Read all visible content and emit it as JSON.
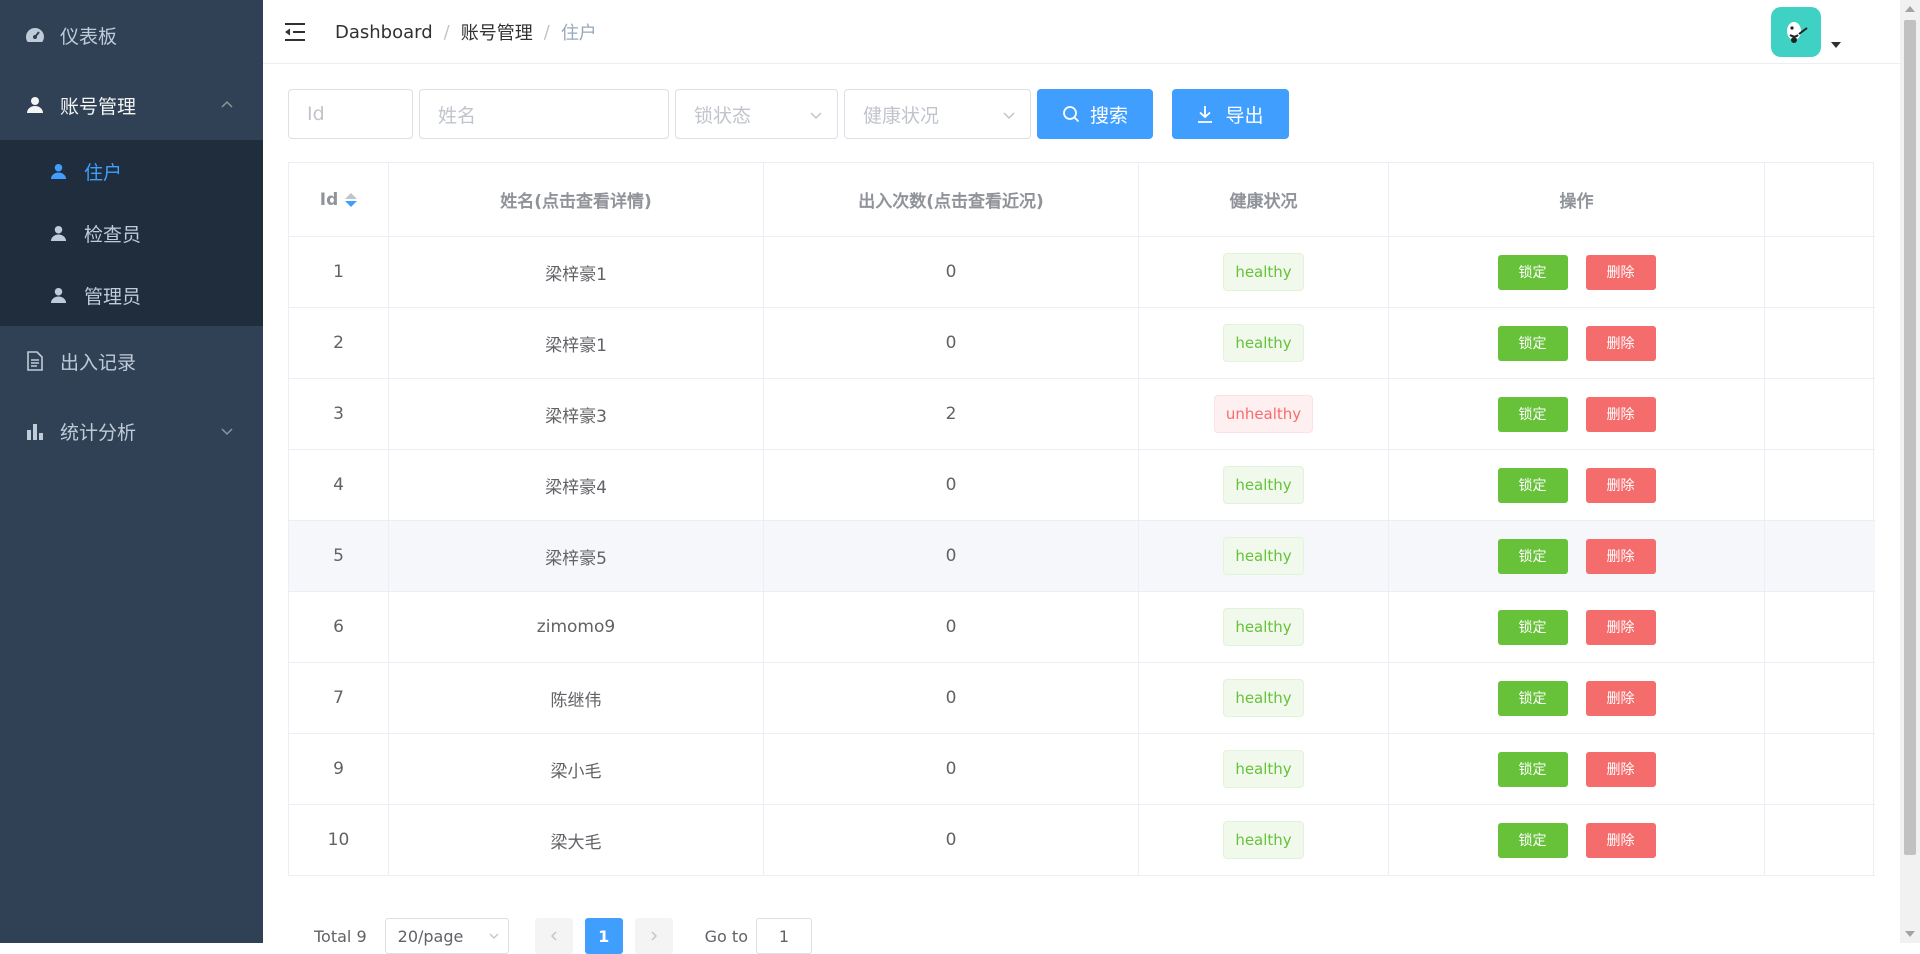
{
  "sidebar": {
    "items": [
      {
        "label": "仪表板",
        "icon": "dashboard-icon"
      },
      {
        "label": "账号管理",
        "icon": "user-icon",
        "expanded": true,
        "children": [
          {
            "label": "住户",
            "icon": "user-icon",
            "active": true
          },
          {
            "label": "检查员",
            "icon": "user-icon"
          },
          {
            "label": "管理员",
            "icon": "user-icon"
          }
        ]
      },
      {
        "label": "出入记录",
        "icon": "document-icon"
      },
      {
        "label": "统计分析",
        "icon": "bar-chart-icon",
        "expanded": false
      }
    ]
  },
  "breadcrumb": [
    "Dashboard",
    "账号管理",
    "住户"
  ],
  "filters": {
    "id_placeholder": "Id",
    "name_placeholder": "姓名",
    "lock_placeholder": "锁状态",
    "health_placeholder": "健康状况",
    "search_label": "搜索",
    "export_label": "导出"
  },
  "table": {
    "headers": [
      "Id",
      "姓名(点击查看详情)",
      "出入次数(点击查看近况)",
      "健康状况",
      "操作"
    ],
    "lock_label": "锁定",
    "delete_label": "删除",
    "rows": [
      {
        "id": "1",
        "name": "梁梓豪1",
        "count": "0",
        "health": "healthy"
      },
      {
        "id": "2",
        "name": "梁梓豪1",
        "count": "0",
        "health": "healthy"
      },
      {
        "id": "3",
        "name": "梁梓豪3",
        "count": "2",
        "health": "unhealthy"
      },
      {
        "id": "4",
        "name": "梁梓豪4",
        "count": "0",
        "health": "healthy"
      },
      {
        "id": "5",
        "name": "梁梓豪5",
        "count": "0",
        "health": "healthy"
      },
      {
        "id": "6",
        "name": "zimomo9",
        "count": "0",
        "health": "healthy"
      },
      {
        "id": "7",
        "name": "陈继伟",
        "count": "0",
        "health": "healthy"
      },
      {
        "id": "9",
        "name": "梁小毛",
        "count": "0",
        "health": "healthy"
      },
      {
        "id": "10",
        "name": "梁大毛",
        "count": "0",
        "health": "healthy"
      }
    ]
  },
  "pagination": {
    "total": "Total 9",
    "page_size": "20/page",
    "current_page": "1",
    "goto_label": "Go to",
    "goto_value": "1"
  },
  "colors": {
    "sidebar_bg": "#304156",
    "submenu_bg": "#1f2d3d",
    "primary": "#409eff",
    "success": "#67c23a",
    "danger": "#f56c6c"
  }
}
